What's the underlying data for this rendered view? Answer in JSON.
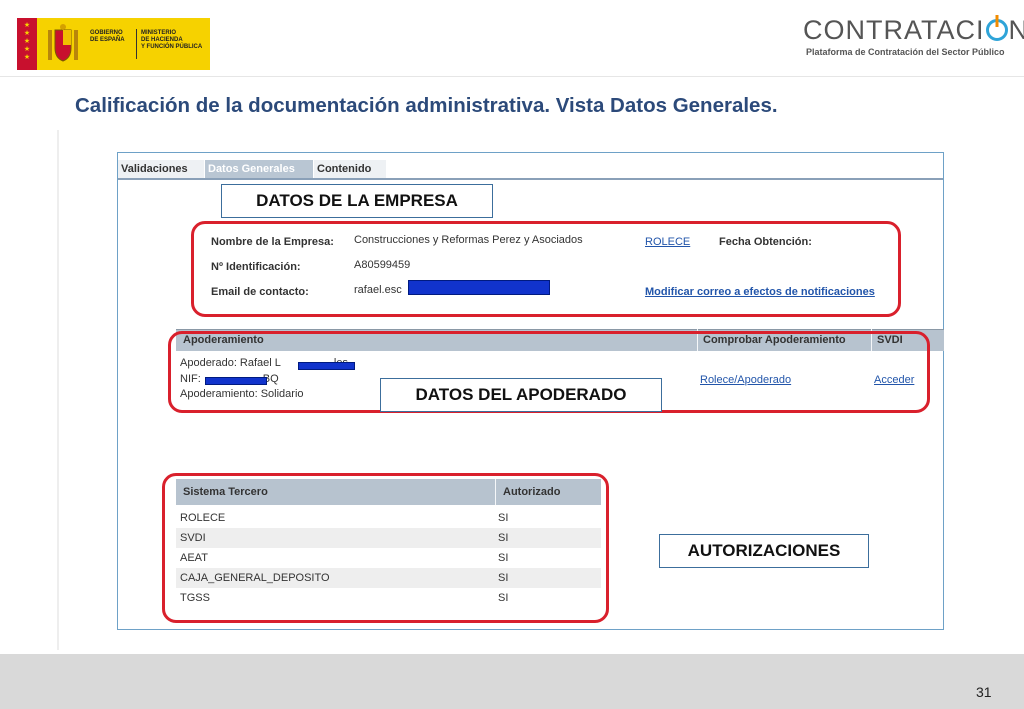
{
  "header": {
    "gov_logo": {
      "line1": [
        "GOBIERNO",
        "DE ESPAÑA"
      ],
      "line2": [
        "MINISTERIO",
        "DE HACIENDA",
        "Y FUNCIÓN PÚBLICA"
      ]
    },
    "brand_title_pre": "CONTRATACI",
    "brand_title_post": "N",
    "brand_subtitle": "Plataforma de Contratación del Sector Público",
    "colors": {
      "brand_blue": "#2fa4d8",
      "brand_orange": "#f28c00",
      "gov_yellow": "#f6d200",
      "gov_red": "#c8102e"
    }
  },
  "page_title": "Calificación de la documentación administrativa. Vista Datos Generales.",
  "tabs": [
    "Validaciones",
    "Datos Generales",
    "Contenido"
  ],
  "callouts": {
    "empresa": "DATOS DE LA EMPRESA",
    "apoderado": "DATOS DEL APODERADO",
    "autorizaciones": "AUTORIZACIONES"
  },
  "empresa": {
    "nombre_label": "Nombre de la Empresa:",
    "nombre_value": "Construcciones y Reformas Perez y Asociados",
    "rolece_link": "ROLECE",
    "fecha_label": "Fecha Obtención:",
    "id_label": "Nº Identificación:",
    "id_value": "A80599459",
    "email_label": "Email de contacto:",
    "email_value": "rafael.esc",
    "modificar_link": "Modificar correo a efectos de notificaciones"
  },
  "apoderamiento": {
    "headers": [
      "Apoderamiento",
      "Comprobar Apoderamiento",
      "SVDI"
    ],
    "apoderado_label": "Apoderado: Rafael L",
    "apoderado_suffix": "les",
    "nif_label": "NIF:",
    "nif_suffix": "BQ",
    "tipo": "Apoderamiento: Solidario",
    "rolece_link": "Rolece/Apoderado",
    "acceder_link": "Acceder"
  },
  "sistemas": {
    "headers": [
      "Sistema Tercero",
      "Autorizado"
    ],
    "rows": [
      {
        "sistema": "ROLECE",
        "autorizado": "SI"
      },
      {
        "sistema": "SVDI",
        "autorizado": "SI"
      },
      {
        "sistema": "AEAT",
        "autorizado": "SI"
      },
      {
        "sistema": "CAJA_GENERAL_DEPOSITO",
        "autorizado": "SI"
      },
      {
        "sistema": "TGSS",
        "autorizado": "SI"
      }
    ]
  },
  "page_number": "31"
}
